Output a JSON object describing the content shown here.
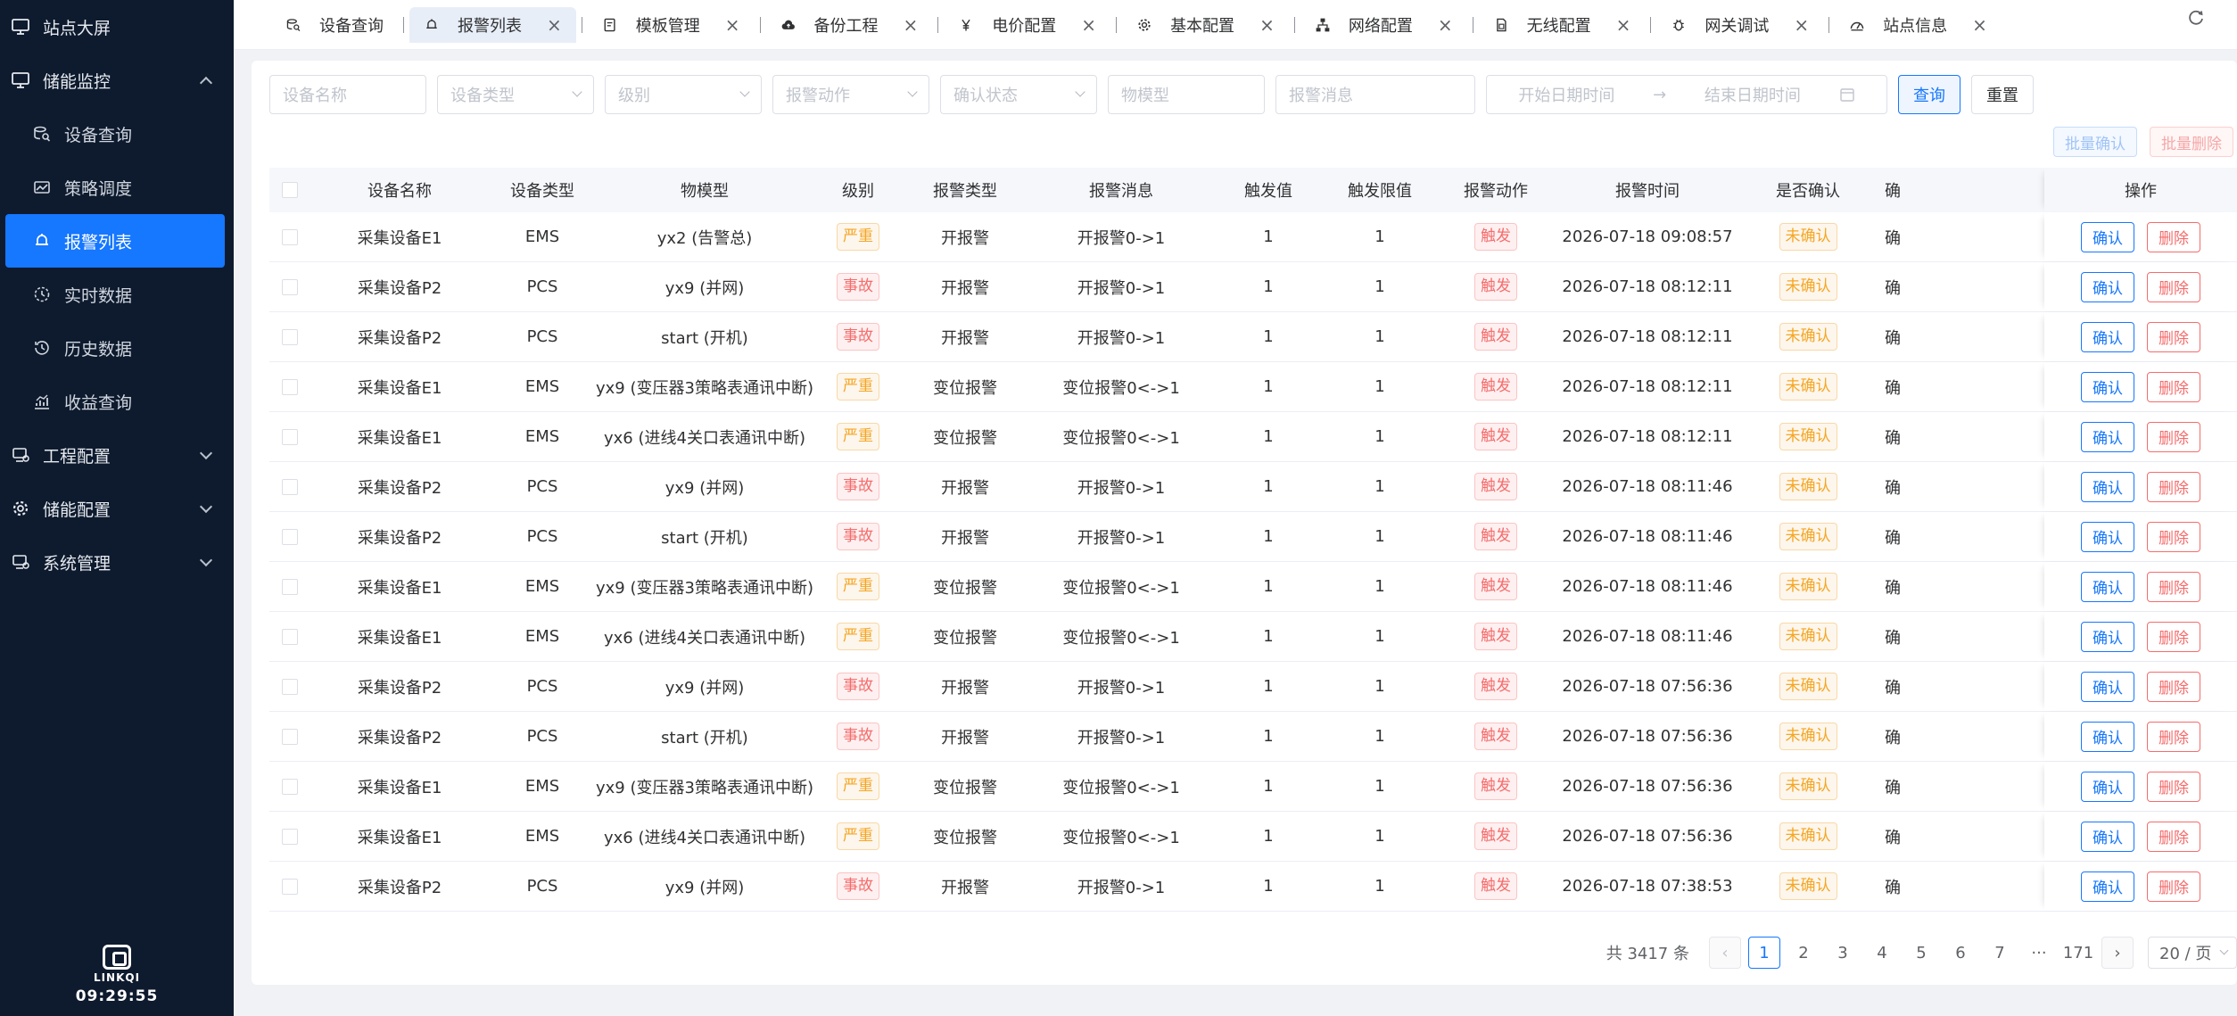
{
  "sidebar": {
    "items": [
      {
        "label": "站点大屏",
        "icon": "monitor-icon",
        "level": 1
      },
      {
        "label": "储能监控",
        "icon": "monitor-icon",
        "level": 1,
        "expanded": true
      },
      {
        "label": "设备查询",
        "icon": "device-search-icon",
        "level": 2
      },
      {
        "label": "策略调度",
        "icon": "strategy-icon",
        "level": 2
      },
      {
        "label": "报警列表",
        "icon": "bell-icon",
        "level": 2,
        "active": true
      },
      {
        "label": "实时数据",
        "icon": "clock-icon",
        "level": 2
      },
      {
        "label": "历史数据",
        "icon": "history-icon",
        "level": 2
      },
      {
        "label": "收益查询",
        "icon": "chart-icon",
        "level": 2
      },
      {
        "label": "工程配置",
        "icon": "project-icon",
        "level": 1,
        "collapsed": true
      },
      {
        "label": "储能配置",
        "icon": "gear-icon",
        "level": 1,
        "collapsed": true
      },
      {
        "label": "系统管理",
        "icon": "project-icon",
        "level": 1,
        "collapsed": true
      }
    ],
    "logo_text": "LINKQI",
    "clock": "09:29:55"
  },
  "tabs": [
    {
      "label": "设备查询",
      "icon": "device-search-icon",
      "closable": false
    },
    {
      "label": "报警列表",
      "icon": "bell-icon",
      "closable": true,
      "active": true
    },
    {
      "label": "模板管理",
      "icon": "template-icon",
      "closable": true
    },
    {
      "label": "备份工程",
      "icon": "cloud-icon",
      "closable": true
    },
    {
      "label": "电价配置",
      "icon": "yen-icon",
      "closable": true
    },
    {
      "label": "基本配置",
      "icon": "gear-icon",
      "closable": true
    },
    {
      "label": "网络配置",
      "icon": "network-icon",
      "closable": true
    },
    {
      "label": "无线配置",
      "icon": "sim-icon",
      "closable": true
    },
    {
      "label": "网关调试",
      "icon": "bug-icon",
      "closable": true
    },
    {
      "label": "站点信息",
      "icon": "dashboard-icon",
      "closable": true
    }
  ],
  "filters": {
    "device_name": "设备名称",
    "device_type": "设备类型",
    "level": "级别",
    "alarm_action": "报警动作",
    "confirm_status": "确认状态",
    "model": "物模型",
    "alarm_message": "报警消息",
    "start_date": "开始日期时间",
    "end_date": "结束日期时间",
    "query_label": "查询",
    "reset_label": "重置",
    "batch_confirm": "批量确认",
    "batch_delete": "批量删除"
  },
  "table": {
    "columns": [
      "设备名称",
      "设备类型",
      "物模型",
      "级别",
      "报警类型",
      "报警消息",
      "触发值",
      "触发限值",
      "报警动作",
      "报警时间",
      "是否确认",
      "确",
      "操作"
    ],
    "confirm_label": "确认",
    "delete_label": "删除",
    "rows": [
      {
        "name": "采集设备E1",
        "type": "EMS",
        "model": "yx2 (告警总)",
        "level": "严重",
        "level_color": "yellow",
        "alarm_type": "开报警",
        "message": "开报警0->1",
        "value": "1",
        "limit": "1",
        "action": "触发",
        "time": "2026-07-18 09:08:57",
        "confirmed": "未确认",
        "extra": "确"
      },
      {
        "name": "采集设备P2",
        "type": "PCS",
        "model": "yx9 (并网)",
        "level": "事故",
        "level_color": "red",
        "alarm_type": "开报警",
        "message": "开报警0->1",
        "value": "1",
        "limit": "1",
        "action": "触发",
        "time": "2026-07-18 08:12:11",
        "confirmed": "未确认",
        "extra": "确"
      },
      {
        "name": "采集设备P2",
        "type": "PCS",
        "model": "start (开机)",
        "level": "事故",
        "level_color": "red",
        "alarm_type": "开报警",
        "message": "开报警0->1",
        "value": "1",
        "limit": "1",
        "action": "触发",
        "time": "2026-07-18 08:12:11",
        "confirmed": "未确认",
        "extra": "确"
      },
      {
        "name": "采集设备E1",
        "type": "EMS",
        "model": "yx9 (变压器3策略表通讯中断)",
        "level": "严重",
        "level_color": "yellow",
        "alarm_type": "变位报警",
        "message": "变位报警0<->1",
        "value": "1",
        "limit": "1",
        "action": "触发",
        "time": "2026-07-18 08:12:11",
        "confirmed": "未确认",
        "extra": "确"
      },
      {
        "name": "采集设备E1",
        "type": "EMS",
        "model": "yx6 (进线4关口表通讯中断)",
        "level": "严重",
        "level_color": "yellow",
        "alarm_type": "变位报警",
        "message": "变位报警0<->1",
        "value": "1",
        "limit": "1",
        "action": "触发",
        "time": "2026-07-18 08:12:11",
        "confirmed": "未确认",
        "extra": "确"
      },
      {
        "name": "采集设备P2",
        "type": "PCS",
        "model": "yx9 (并网)",
        "level": "事故",
        "level_color": "red",
        "alarm_type": "开报警",
        "message": "开报警0->1",
        "value": "1",
        "limit": "1",
        "action": "触发",
        "time": "2026-07-18 08:11:46",
        "confirmed": "未确认",
        "extra": "确"
      },
      {
        "name": "采集设备P2",
        "type": "PCS",
        "model": "start (开机)",
        "level": "事故",
        "level_color": "red",
        "alarm_type": "开报警",
        "message": "开报警0->1",
        "value": "1",
        "limit": "1",
        "action": "触发",
        "time": "2026-07-18 08:11:46",
        "confirmed": "未确认",
        "extra": "确"
      },
      {
        "name": "采集设备E1",
        "type": "EMS",
        "model": "yx9 (变压器3策略表通讯中断)",
        "level": "严重",
        "level_color": "yellow",
        "alarm_type": "变位报警",
        "message": "变位报警0<->1",
        "value": "1",
        "limit": "1",
        "action": "触发",
        "time": "2026-07-18 08:11:46",
        "confirmed": "未确认",
        "extra": "确"
      },
      {
        "name": "采集设备E1",
        "type": "EMS",
        "model": "yx6 (进线4关口表通讯中断)",
        "level": "严重",
        "level_color": "yellow",
        "alarm_type": "变位报警",
        "message": "变位报警0<->1",
        "value": "1",
        "limit": "1",
        "action": "触发",
        "time": "2026-07-18 08:11:46",
        "confirmed": "未确认",
        "extra": "确"
      },
      {
        "name": "采集设备P2",
        "type": "PCS",
        "model": "yx9 (并网)",
        "level": "事故",
        "level_color": "red",
        "alarm_type": "开报警",
        "message": "开报警0->1",
        "value": "1",
        "limit": "1",
        "action": "触发",
        "time": "2026-07-18 07:56:36",
        "confirmed": "未确认",
        "extra": "确"
      },
      {
        "name": "采集设备P2",
        "type": "PCS",
        "model": "start (开机)",
        "level": "事故",
        "level_color": "red",
        "alarm_type": "开报警",
        "message": "开报警0->1",
        "value": "1",
        "limit": "1",
        "action": "触发",
        "time": "2026-07-18 07:56:36",
        "confirmed": "未确认",
        "extra": "确"
      },
      {
        "name": "采集设备E1",
        "type": "EMS",
        "model": "yx9 (变压器3策略表通讯中断)",
        "level": "严重",
        "level_color": "yellow",
        "alarm_type": "变位报警",
        "message": "变位报警0<->1",
        "value": "1",
        "limit": "1",
        "action": "触发",
        "time": "2026-07-18 07:56:36",
        "confirmed": "未确认",
        "extra": "确"
      },
      {
        "name": "采集设备E1",
        "type": "EMS",
        "model": "yx6 (进线4关口表通讯中断)",
        "level": "严重",
        "level_color": "yellow",
        "alarm_type": "变位报警",
        "message": "变位报警0<->1",
        "value": "1",
        "limit": "1",
        "action": "触发",
        "time": "2026-07-18 07:56:36",
        "confirmed": "未确认",
        "extra": "确"
      },
      {
        "name": "采集设备P2",
        "type": "PCS",
        "model": "yx9 (并网)",
        "level": "事故",
        "level_color": "red",
        "alarm_type": "开报警",
        "message": "开报警0->1",
        "value": "1",
        "limit": "1",
        "action": "触发",
        "time": "2026-07-18 07:38:53",
        "confirmed": "未确认",
        "extra": "确"
      }
    ]
  },
  "pagination": {
    "total": "共 3417 条",
    "pages": [
      "1",
      "2",
      "3",
      "4",
      "5",
      "6",
      "7",
      "···",
      "171"
    ],
    "current": "1",
    "page_size": "20 / 页"
  },
  "colors": {
    "primary": "#1677ff",
    "sidebar_bg": "#0e1b2e",
    "tag_yellow": "#f5a623",
    "tag_red": "#f56c6c"
  }
}
